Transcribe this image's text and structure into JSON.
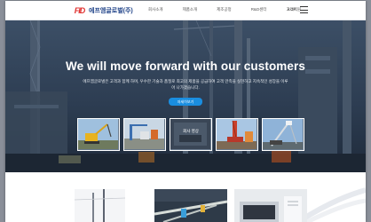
{
  "header": {
    "logo_mark": "FID",
    "logo_text": "에프엠글로벌(주)",
    "nav": [
      "회사소개",
      "제품소개",
      "제조공정",
      "R&D센터",
      "고객지원"
    ],
    "language": "KOR"
  },
  "hero": {
    "title": "We will move forward with our customers",
    "description": "에프엠글로벌은 고객과 함께 하며, 우수한 기술과 품질로 최고의 제품을 공급하여 고객 만족을 실현하고 지속적인 성장을 이루어 나가겠습니다.",
    "more_button": "자세히보기",
    "thumbnails": [
      {
        "name": "product-excavator",
        "label": ""
      },
      {
        "name": "product-site",
        "label": ""
      },
      {
        "name": "product-video",
        "label": "회사 영상"
      },
      {
        "name": "product-crane-red",
        "label": ""
      },
      {
        "name": "product-drill-rig",
        "label": ""
      }
    ]
  },
  "colors": {
    "brand_blue": "#1f56b8",
    "brand_red": "#e0312f",
    "button_blue": "#1a8ee0",
    "hero_overlay": "#27364a"
  }
}
